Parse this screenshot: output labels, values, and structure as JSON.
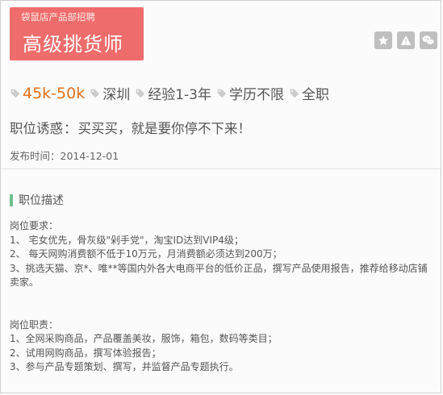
{
  "header": {
    "subtitle": "袋鼠店产品部招聘",
    "title": "高级挑货师"
  },
  "actions": {
    "icons": [
      "star-icon",
      "warning-icon",
      "wechat-icon"
    ]
  },
  "tags": {
    "salary": "45k-50k",
    "location": "深圳",
    "experience": "经验1-3年",
    "education": "学历不限",
    "type": "全职"
  },
  "benefit": {
    "label": "职位诱惑",
    "separator": "：",
    "text": "买买买，就是要你停不下来！"
  },
  "post_date": {
    "label": "发布时间：",
    "value": "2014-12-01"
  },
  "section": {
    "title": "职位描述"
  },
  "requirements": {
    "heading": "岗位要求：",
    "items": [
      "1、 宅女优先，骨灰级\"剁手党\"，淘宝ID达到VIP4级；",
      "2、 每天网购消费额不低于10万元，月消费额必须达到200万；",
      "3、挑选天猫、京*、唯**等国内外各大电商平台的低价正品，撰写产品使用报告，推荐给移动店铺卖家。"
    ]
  },
  "duties": {
    "heading": "岗位职责：",
    "items": [
      "1、全网采购商品，产品覆盖美妆，服饰，箱包，数码等类目；",
      "2、试用网购商品，撰写体验报告；",
      "3、参与产品专题策划、撰写，并监督产品专题执行。"
    ]
  },
  "colors": {
    "banner": "#ef6c6c",
    "salary": "#e2711d",
    "accent_bar": "#6fbf8f",
    "action_btn": "#bfbfbf"
  }
}
